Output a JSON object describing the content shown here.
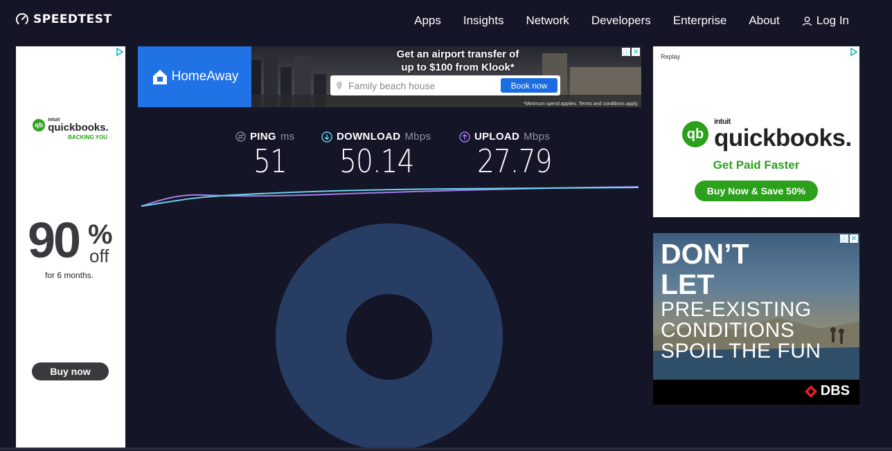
{
  "header": {
    "logo_text": "SPEEDTEST",
    "nav": [
      "Apps",
      "Insights",
      "Network",
      "Developers",
      "Enterprise",
      "About"
    ],
    "login_label": "Log In"
  },
  "left_ad": {
    "brand_intuit": "intuit",
    "brand": "quickbooks.",
    "tagline": "BACKING YOU",
    "big_number": "90",
    "percent": "%",
    "off": "off",
    "duration": "for 6 months.",
    "cta": "Buy now"
  },
  "top_banner": {
    "brand": "HomeAway",
    "headline_line1": "Get an airport transfer of",
    "headline_line2": "up to $100 from Klook*",
    "search_placeholder": "Family beach house",
    "cta": "Book now",
    "fine_print": "*Minimum spend applies. Terms and conditions apply."
  },
  "stats": {
    "ping": {
      "label": "PING",
      "unit": "ms",
      "value": "51"
    },
    "download": {
      "label": "DOWNLOAD",
      "unit": "Mbps",
      "value": "50.14"
    },
    "upload": {
      "label": "UPLOAD",
      "unit": "Mbps",
      "value": "27.79"
    }
  },
  "right_ad1": {
    "replay": "Replay",
    "brand_intuit": "intuit",
    "brand": "quickbooks.",
    "headline": "Get Paid Faster",
    "cta": "Buy Now & Save 50%"
  },
  "right_ad2": {
    "line1": "DON’T",
    "line2": "LET",
    "line3": "PRE-EXISTING",
    "line4": "CONDITIONS",
    "line5": "SPOIL THE FUN",
    "brand": "DBS"
  },
  "colors": {
    "background": "#141526",
    "download_line": "#6ad4f0",
    "upload_line": "#a77ff0",
    "gauge": "#283d63",
    "quickbooks_green": "#2ca01c",
    "homeaway_blue": "#2172e5"
  }
}
